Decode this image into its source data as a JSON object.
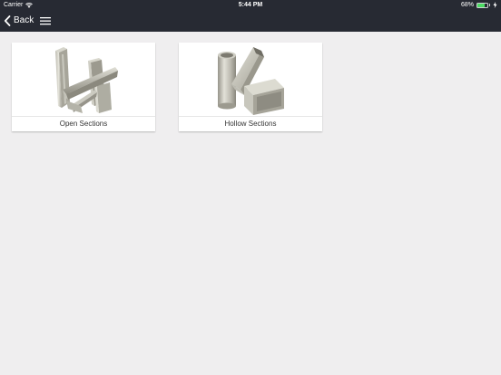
{
  "status_bar": {
    "carrier": "Carrier",
    "time": "5:44 PM",
    "battery_percent": "68%",
    "battery_level": 0.68,
    "icons": [
      "wifi-icon",
      "battery-icon",
      "charging-icon"
    ]
  },
  "nav": {
    "back_label": "Back",
    "icons": [
      "chevron-left-icon",
      "hamburger-menu-icon"
    ]
  },
  "cards": [
    {
      "label": "Open Sections",
      "image": "open-sections-beams-image"
    },
    {
      "label": "Hollow Sections",
      "image": "hollow-sections-tubes-image"
    }
  ],
  "colors": {
    "topbar": "#272a33",
    "background": "#efeeef",
    "battery_fill": "#4cd964",
    "steel_light": "#e3e2d9",
    "steel_dark": "#8e8d83"
  }
}
